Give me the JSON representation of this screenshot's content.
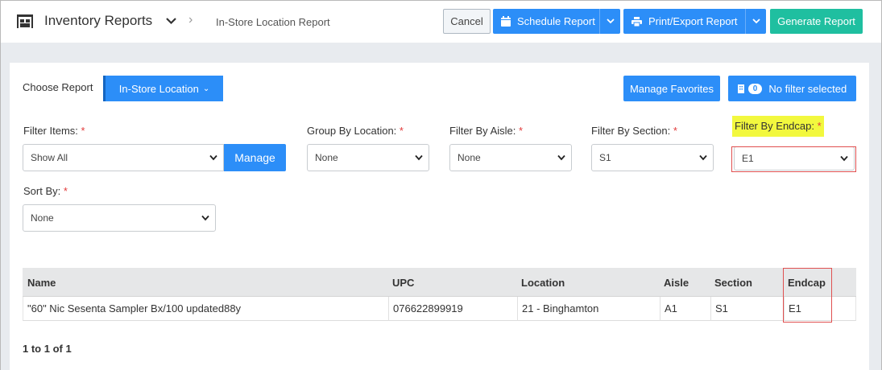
{
  "header": {
    "app_title": "Inventory Reports",
    "breadcrumb": "In-Store Location Report",
    "cancel_label": "Cancel",
    "schedule_label": "Schedule Report",
    "print_label": "Print/Export Report",
    "generate_label": "Generate Report"
  },
  "report_bar": {
    "choose_label": "Choose Report",
    "selected_report": "In-Store Location",
    "favorites_label": "Manage Favorites",
    "filter_count": "0",
    "filter_status": "No filter selected"
  },
  "filters": {
    "filter_items": {
      "label": "Filter Items:",
      "value": "Show All",
      "manage_label": "Manage"
    },
    "group_by_location": {
      "label": "Group By Location:",
      "value": "None"
    },
    "filter_by_aisle": {
      "label": "Filter By Aisle:",
      "value": "None"
    },
    "filter_by_section": {
      "label": "Filter By Section:",
      "value": "S1"
    },
    "filter_by_endcap": {
      "label": "Filter By Endcap:",
      "value": "E1"
    },
    "sort_by": {
      "label": "Sort By:",
      "value": "None"
    },
    "required_mark": "*"
  },
  "table": {
    "columns": [
      "Name",
      "UPC",
      "Location",
      "Aisle",
      "Section",
      "Endcap"
    ],
    "rows": [
      [
        "\"60\" Nic Sesenta Sampler Bx/100 updated88y",
        "076622899919",
        "21 - Binghamton",
        "A1",
        "S1",
        "E1"
      ]
    ]
  },
  "pagination": {
    "text": "1 to 1 of 1"
  },
  "colors": {
    "primary": "#2c8ef8",
    "success": "#1fbfa0",
    "highlight": "#f2f83e",
    "required": "#e23b3b",
    "annotation": "#e05050"
  }
}
